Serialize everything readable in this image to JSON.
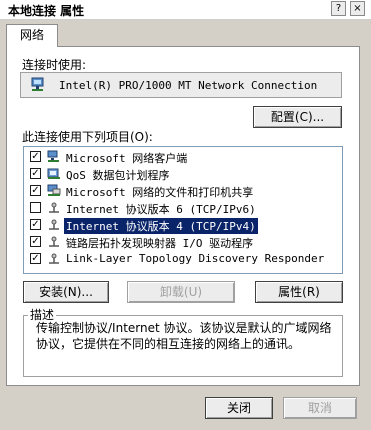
{
  "window": {
    "title": "本地连接 属性",
    "help_label": "?",
    "close_label": "×"
  },
  "tabs": [
    {
      "label": "网络"
    }
  ],
  "connection": {
    "label": "连接时使用:",
    "adapter": "Intel(R) PRO/1000 MT Network Connection",
    "configure_label": "配置(C)..."
  },
  "components": {
    "label": "此连接使用下列项目(O):",
    "items": [
      {
        "label": "Microsoft 网络客户端",
        "checked": true,
        "icon": "network-client-icon"
      },
      {
        "label": "QoS 数据包计划程序",
        "checked": true,
        "icon": "qos-scheduler-icon"
      },
      {
        "label": "Microsoft 网络的文件和打印机共享",
        "checked": true,
        "icon": "file-print-sharing-icon"
      },
      {
        "label": "Internet 协议版本 6 (TCP/IPv6)",
        "checked": false,
        "icon": "protocol-icon"
      },
      {
        "label": "Internet 协议版本 4 (TCP/IPv4)",
        "checked": true,
        "icon": "protocol-icon",
        "selected": true
      },
      {
        "label": "链路层拓扑发现映射器 I/O 驱动程序",
        "checked": true,
        "icon": "protocol-icon"
      },
      {
        "label": "Link-Layer Topology Discovery Responder",
        "checked": true,
        "icon": "protocol-icon"
      }
    ]
  },
  "actions": {
    "install": "安装(N)...",
    "uninstall": "卸载(U)",
    "properties": "属性(R)"
  },
  "description": {
    "legend": "描述",
    "text": "传输控制协议/Internet 协议。该协议是默认的广域网络协议，它提供在不同的相互连接的网络上的通讯。"
  },
  "footer": {
    "close": "关闭",
    "cancel": "取消"
  },
  "colors": {
    "selection": "#0a246a",
    "dialog_bg": "#d4d0c8"
  }
}
